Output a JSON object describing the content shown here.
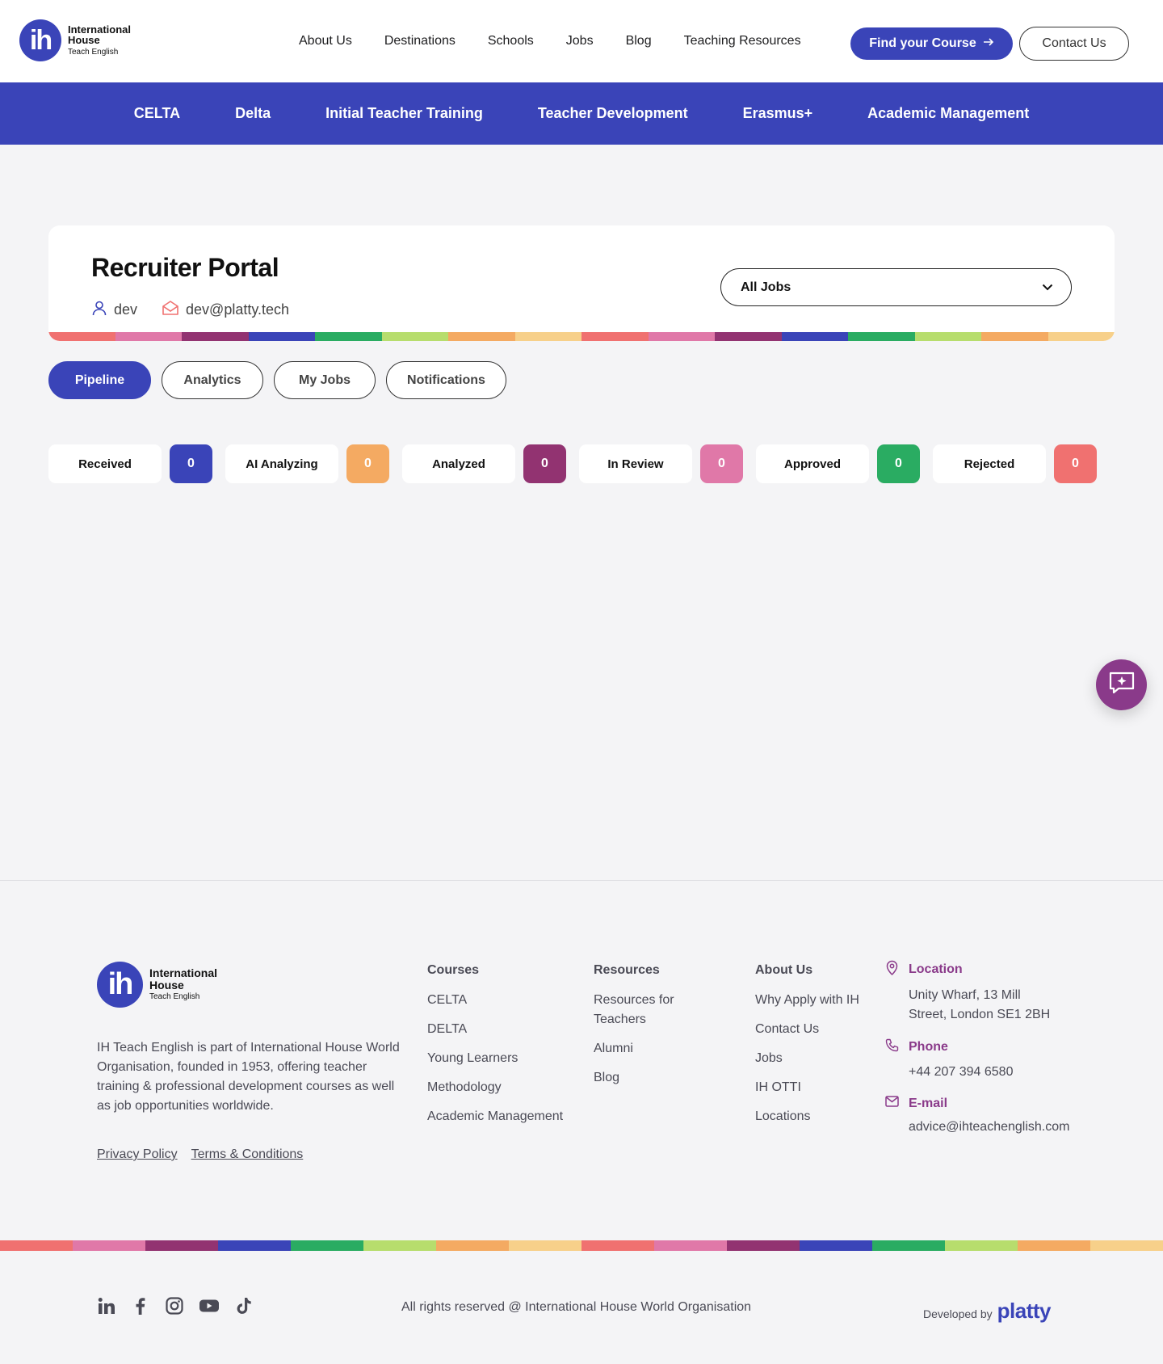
{
  "header": {
    "logo": {
      "mark": "ih",
      "line1": "International",
      "line2": "House",
      "line3": "Teach English"
    },
    "nav": [
      "About Us",
      "Destinations",
      "Schools",
      "Jobs",
      "Blog",
      "Teaching Resources"
    ],
    "find_course": "Find your Course",
    "contact": "Contact Us"
  },
  "subnav": [
    "CELTA",
    "Delta",
    "Initial Teacher Training",
    "Teacher Development",
    "Erasmus+",
    "Academic Management"
  ],
  "portal": {
    "title": "Recruiter Portal",
    "username": "dev",
    "email": "dev@platty.tech",
    "job_filter": "All Jobs"
  },
  "tabs": [
    {
      "label": "Pipeline",
      "active": true
    },
    {
      "label": "Analytics",
      "active": false
    },
    {
      "label": "My Jobs",
      "active": false
    },
    {
      "label": "Notifications",
      "active": false
    }
  ],
  "pipeline": [
    {
      "label": "Received",
      "count": "0",
      "color": "#3a44b8"
    },
    {
      "label": "AI Analyzing",
      "count": "0",
      "color": "#f4aa62"
    },
    {
      "label": "Analyzed",
      "count": "0",
      "color": "#923371"
    },
    {
      "label": "In Review",
      "count": "0",
      "color": "#e078a8"
    },
    {
      "label": "Approved",
      "count": "0",
      "color": "#2aac62"
    },
    {
      "label": "Rejected",
      "count": "0",
      "color": "#f07170"
    }
  ],
  "rainbow_colors": [
    "#f07170",
    "#e078a8",
    "#923371",
    "#3a44b8",
    "#2aac62",
    "#b7dd6d",
    "#f4aa62",
    "#f7d08a"
  ],
  "footer": {
    "logo": {
      "mark": "ih",
      "line1": "International",
      "line2": "House",
      "line3": "Teach English"
    },
    "description": "IH Teach English is part of International House World Organisation, founded in 1953, offering teacher training & professional development courses as well as job opportunities worldwide.",
    "privacy": "Privacy Policy",
    "terms": "Terms & Conditions",
    "courses": {
      "title": "Courses",
      "items": [
        "CELTA",
        "DELTA",
        "Young Learners",
        "Methodology",
        "Academic Management"
      ]
    },
    "resources": {
      "title": "Resources",
      "items": [
        "Resources for Teachers",
        "Alumni",
        "Blog"
      ]
    },
    "about": {
      "title": "About Us",
      "items": [
        "Why Apply with IH",
        "Contact Us",
        "Jobs",
        "IH OTTI",
        "Locations"
      ]
    },
    "location_label": "Location",
    "location_value": "Unity Wharf, 13 Mill Street, London SE1 2BH",
    "phone_label": "Phone",
    "phone_value": "+44 207 394 6580",
    "email_label": "E-mail",
    "email_value": "advice@ihteachenglish.com",
    "copyright": "All rights reserved @ International House World Organisation",
    "developed_by": "Developed by",
    "developer": "platty",
    "socials": [
      "linkedin-icon",
      "facebook-icon",
      "instagram-icon",
      "youtube-icon",
      "tiktok-icon"
    ]
  }
}
